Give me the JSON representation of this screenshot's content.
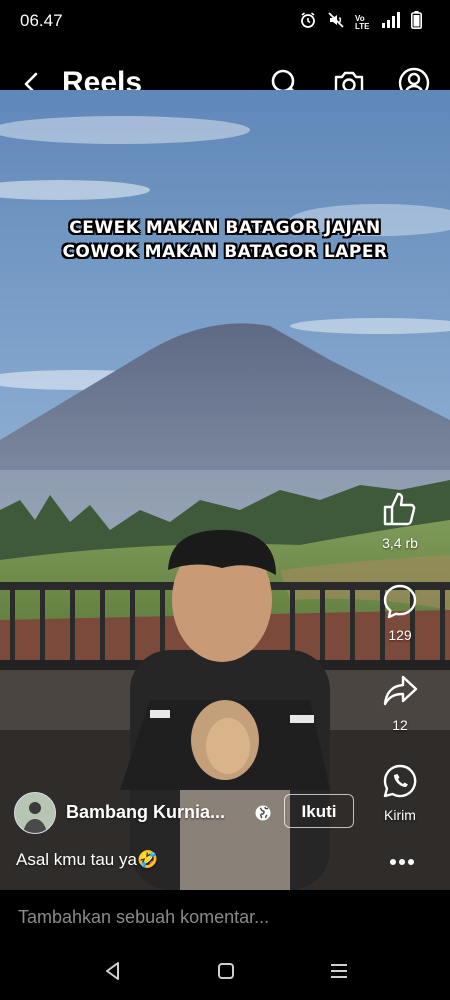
{
  "status_bar": {
    "time": "06.47",
    "icons": [
      "alarm-icon",
      "mute-icon",
      "volte-icon",
      "signal-icon",
      "battery-icon"
    ],
    "volte_label": "Vo LTE"
  },
  "header": {
    "title": "Reels",
    "icons": [
      "back-icon",
      "search-icon",
      "camera-icon",
      "profile-icon"
    ]
  },
  "video": {
    "overlay_text_line1": "CEWEK MAKAN BATAGOR JAJAN",
    "overlay_text_line2": "COWOK MAKAN BATAGOR LAPER",
    "sky_color": "#6f95c2",
    "mountain_color": "#6d7890"
  },
  "actions": {
    "like_count": "3,4 rb",
    "comment_count": "129",
    "share_count": "12",
    "send_label": "Kirim"
  },
  "post": {
    "author_name": "Bambang Kurnia...",
    "follow_label": "Ikuti",
    "caption": "Asal kmu tau ya🤣"
  },
  "comment": {
    "placeholder": "Tambahkan sebuah komentar..."
  },
  "nav": {
    "icons": [
      "nav-back-icon",
      "nav-home-icon",
      "nav-recents-icon"
    ]
  }
}
